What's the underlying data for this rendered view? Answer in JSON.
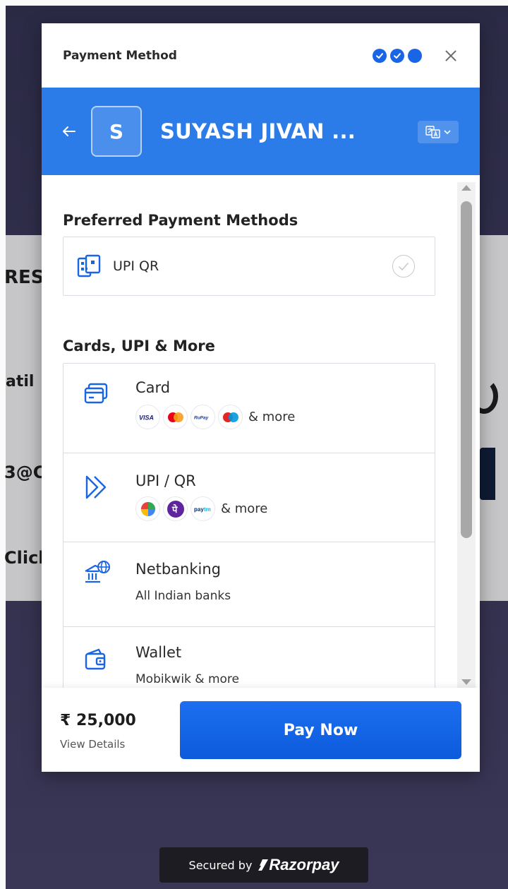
{
  "background": {
    "fragment_res": "RES",
    "fragment_til": "atil",
    "fragment_at": "3@C",
    "fragment_click": "Click"
  },
  "header": {
    "title": "Payment Method",
    "steps_completed": 2,
    "steps_total": 3
  },
  "merchant": {
    "initial": "S",
    "name": "SUYASH JIVAN ...",
    "language_icon": "translate-icon"
  },
  "preferred": {
    "heading": "Preferred Payment Methods",
    "items": [
      {
        "label": "UPI QR",
        "icon": "upi-qr-icon"
      }
    ]
  },
  "methods": {
    "heading": "Cards, UPI & More",
    "items": [
      {
        "label": "Card",
        "icon": "card-icon",
        "logos": [
          "VISA",
          "Mastercard",
          "RuPay",
          "Maestro"
        ],
        "sub": "& more"
      },
      {
        "label": "UPI / QR",
        "icon": "upi-icon",
        "logos": [
          "Google Pay",
          "PhonePe",
          "Paytm"
        ],
        "sub": "& more"
      },
      {
        "label": "Netbanking",
        "icon": "bank-icon",
        "sub": "All Indian banks"
      },
      {
        "label": "Wallet",
        "icon": "wallet-icon",
        "sub": "Mobikwik & more"
      }
    ]
  },
  "footer": {
    "amount": "₹ 25,000",
    "view_details": "View Details",
    "pay_button": "Pay Now"
  },
  "badge": {
    "secured_by": "Secured by",
    "brand": "Razorpay"
  },
  "colors": {
    "brand_blue": "#2b7ce8",
    "pay_button": "#0c5bdc",
    "step_dot": "#1a65e6"
  }
}
